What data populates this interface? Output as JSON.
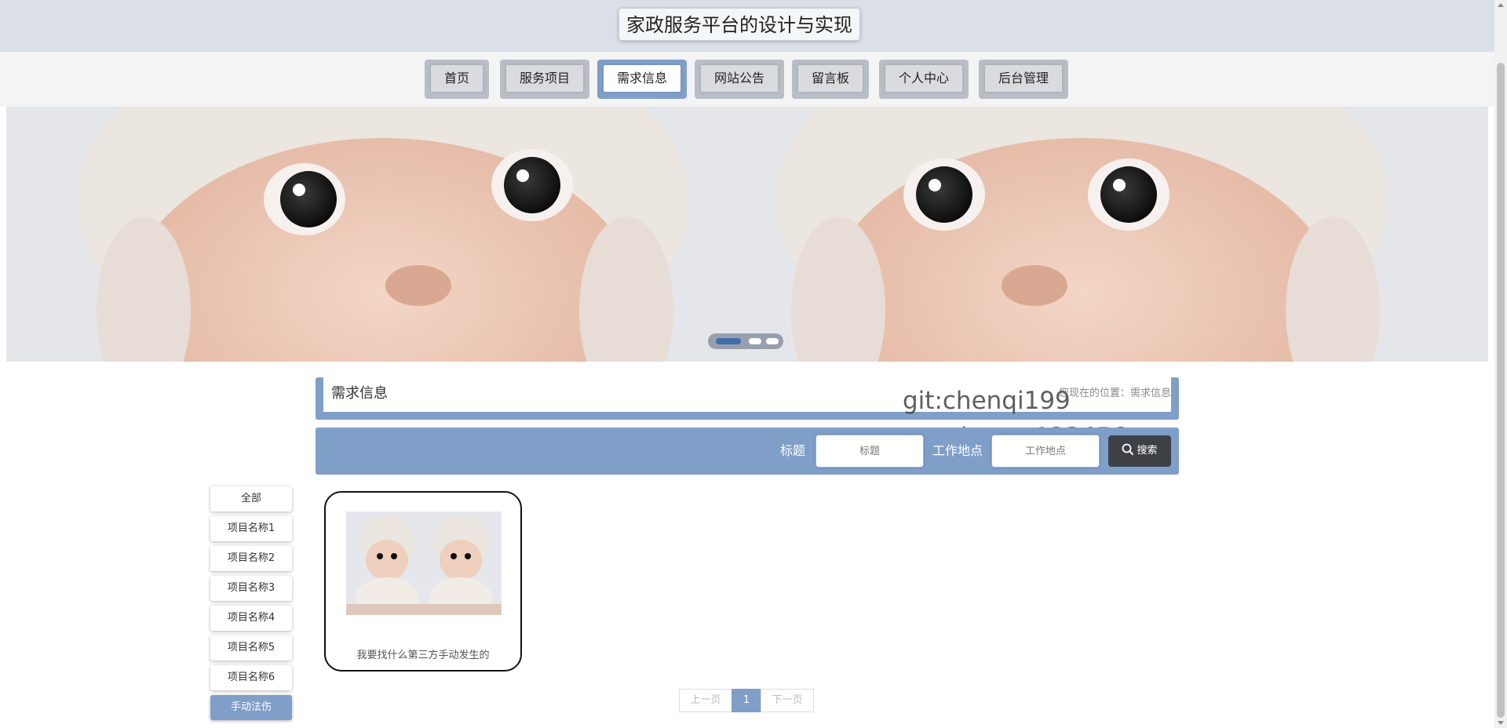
{
  "header": {
    "site_title": "家政服务平台的设计与实现"
  },
  "nav": {
    "items": [
      {
        "label": "首页"
      },
      {
        "label": "服务项目"
      },
      {
        "label": "需求信息",
        "active": true
      },
      {
        "label": "网站公告"
      },
      {
        "label": "留言板"
      },
      {
        "label": "个人中心"
      },
      {
        "label": "后台管理"
      }
    ]
  },
  "banner": {
    "slides": 3,
    "active_slide": 1
  },
  "breadcrumb": {
    "title": "需求信息",
    "prefix": "您现在的位置：",
    "current": "需求信息"
  },
  "watermark": {
    "line1": "git:chenqi199",
    "line2": "v x:chen_q123456"
  },
  "search": {
    "title_label": "标题",
    "title_placeholder": "标题",
    "location_label": "工作地点",
    "location_placeholder": "工作地点",
    "button_label": "搜索"
  },
  "sidebar": {
    "items": [
      {
        "label": "全部"
      },
      {
        "label": "项目名称1"
      },
      {
        "label": "项目名称2"
      },
      {
        "label": "项目名称3"
      },
      {
        "label": "项目名称4"
      },
      {
        "label": "项目名称5"
      },
      {
        "label": "项目名称6"
      },
      {
        "label": "手动法伤",
        "active": true
      }
    ]
  },
  "cards": [
    {
      "title": "我要找什么第三方手动发生的"
    }
  ],
  "pagination": {
    "prev": "上一页",
    "current": "1",
    "next": "下一页"
  },
  "colors": {
    "accent": "#7f9fc9",
    "header_bg": "#dbe0e8",
    "search_button": "#3d4146",
    "dot_active": "#3f6da8"
  }
}
